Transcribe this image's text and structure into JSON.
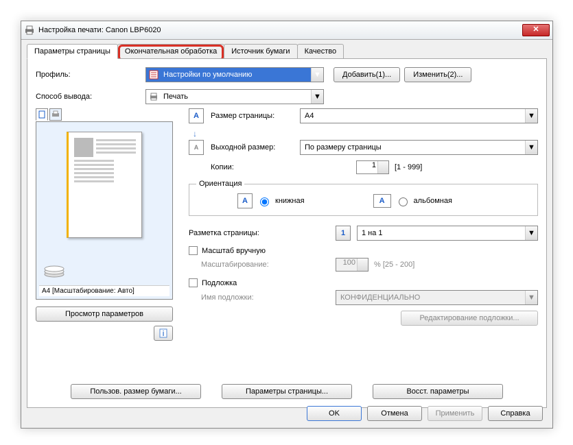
{
  "window": {
    "title": "Настройка печати: Canon LBP6020"
  },
  "tabs": {
    "page": "Параметры страницы",
    "finish": "Окончательная обработка",
    "source": "Источник бумаги",
    "quality": "Качество"
  },
  "profile": {
    "label": "Профиль:",
    "value": "Настройки по умолчанию",
    "add": "Добавить(1)...",
    "edit": "Изменить(2)..."
  },
  "output": {
    "label": "Способ вывода:",
    "value": "Печать"
  },
  "preview": {
    "caption": "A4 [Масштабирование: Авто]",
    "viewParams": "Просмотр параметров"
  },
  "page": {
    "sizeLabel": "Размер страницы:",
    "sizeValue": "A4",
    "outLabel": "Выходной размер:",
    "outValue": "По размеру страницы",
    "copiesLabel": "Копии:",
    "copiesValue": "1",
    "copiesRange": "[1 - 999]"
  },
  "orient": {
    "group": "Ориентация",
    "portrait": "книжная",
    "landscape": "альбомная"
  },
  "layout": {
    "label": "Разметка страницы:",
    "value": "1 на 1"
  },
  "scale": {
    "chk": "Масштаб вручную",
    "label": "Масштабирование:",
    "value": "100",
    "range": "% [25 - 200]"
  },
  "watermark": {
    "chk": "Подложка",
    "nameLabel": "Имя подложки:",
    "nameValue": "КОНФИДЕНЦИАЛЬНО",
    "edit": "Редактирование подложки..."
  },
  "bottom": {
    "custom": "Пользов. размер бумаги...",
    "pageOpts": "Параметры страницы...",
    "restore": "Восст. параметры"
  },
  "dlg": {
    "ok": "OK",
    "cancel": "Отмена",
    "apply": "Применить",
    "help": "Справка"
  }
}
